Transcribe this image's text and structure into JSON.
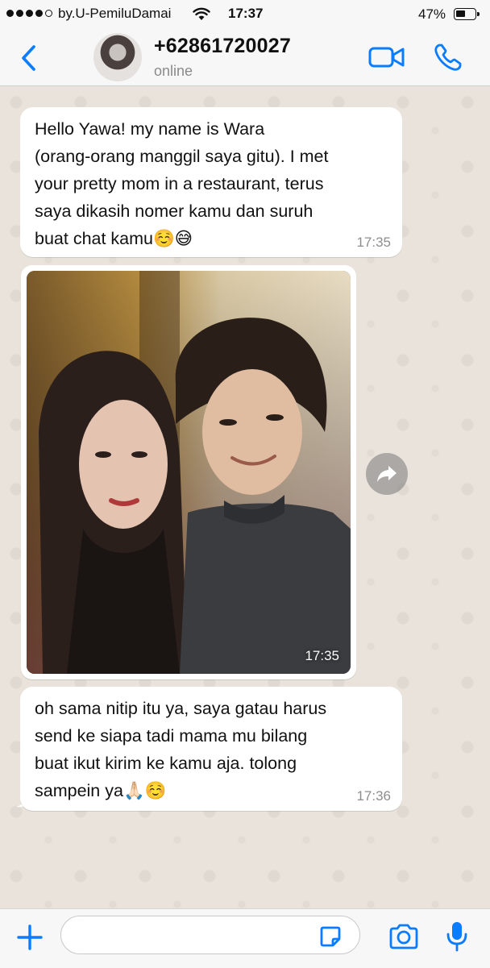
{
  "status_bar": {
    "carrier": "by.U-PemiluDamai",
    "time": "17:37",
    "battery": "47%",
    "battery_level": 0.47
  },
  "header": {
    "back_icon": "chevron-left-icon",
    "contact_name": "+62861720027",
    "contact_status": "online",
    "video_icon": "video-camera-icon",
    "call_icon": "phone-icon",
    "accent_color": "#0a7cff"
  },
  "messages": [
    {
      "text": "Hello Yawa! my name is Wara\n(orang-orang manggil saya gitu). I met\nyour pretty mom in a restaurant, terus\nsaya dikasih nomer kamu dan suruh\nbuat chat kamu☺️😅",
      "time": "17:35"
    },
    {
      "type": "photo",
      "time": "17:35",
      "forward_icon": "forward-arrow-icon"
    },
    {
      "text": "oh sama nitip itu ya, saya gatau harus\nsend ke siapa tadi mama mu bilang\nbuat ikut kirim ke kamu aja. tolong\nsampein ya🙏🏻☺️",
      "time": "17:36"
    }
  ],
  "input_bar": {
    "plus_icon": "plus-icon",
    "placeholder": "",
    "sticker_icon": "sticker-icon",
    "camera_icon": "camera-icon",
    "mic_icon": "microphone-icon"
  }
}
